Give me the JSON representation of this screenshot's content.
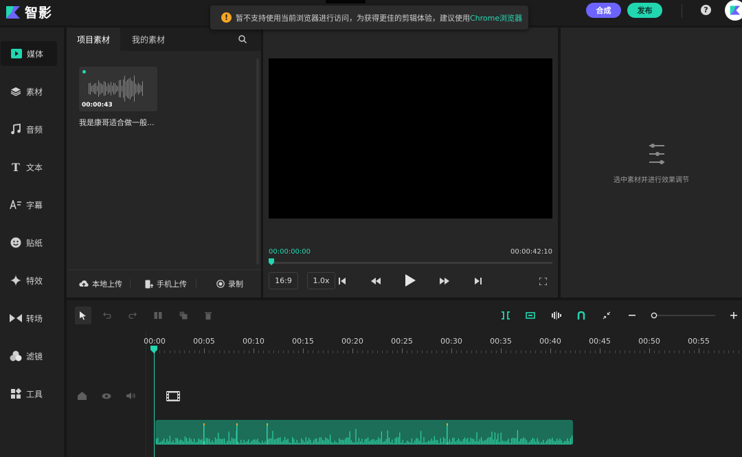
{
  "app": {
    "title": "智影"
  },
  "notice": {
    "text": "暂不支持使用当前浏览器进行访问，为获得更佳的剪辑体验，建议使用",
    "link": "Chrome浏览器"
  },
  "header": {
    "compose_label": "合成",
    "publish_label": "发布",
    "help_glyph": "?"
  },
  "sidebar": {
    "items": [
      {
        "label": "媒体",
        "icon": "media-play-icon",
        "active": true
      },
      {
        "label": "素材",
        "icon": "layers-icon"
      },
      {
        "label": "音频",
        "icon": "music-note-icon"
      },
      {
        "label": "文本",
        "icon": "text-t-icon"
      },
      {
        "label": "字幕",
        "icon": "subtitle-icon"
      },
      {
        "label": "贴纸",
        "icon": "sticker-face-icon"
      },
      {
        "label": "特效",
        "icon": "sparkle-icon"
      },
      {
        "label": "转场",
        "icon": "transition-icon"
      },
      {
        "label": "滤镜",
        "icon": "filter-circles-icon"
      },
      {
        "label": "工具",
        "icon": "tools-grid-icon"
      }
    ]
  },
  "media_panel": {
    "tabs": [
      "项目素材",
      "我的素材"
    ],
    "clip": {
      "duration": "00:00:43",
      "name": "我是康哥适合做一般..."
    },
    "uploads": [
      "本地上传",
      "手机上传",
      "录制"
    ]
  },
  "preview": {
    "time_current": "00:00:00:00",
    "time_total": "00:00:42:10",
    "ratio": "16:9",
    "speed": "1.0x",
    "progress": 0
  },
  "effects": {
    "empty_text": "选中素材并进行效果调节"
  },
  "timeline": {
    "ruler_labels": [
      "00:00",
      "00:05",
      "00:10",
      "00:15",
      "00:20",
      "00:25",
      "00:30",
      "00:35",
      "00:40",
      "00:45",
      "00:50",
      "00:55"
    ],
    "zoom_level": 0
  },
  "colors": {
    "accent": "#22d6b0",
    "compose": "#6d64ff",
    "warning": "#f5a623"
  }
}
